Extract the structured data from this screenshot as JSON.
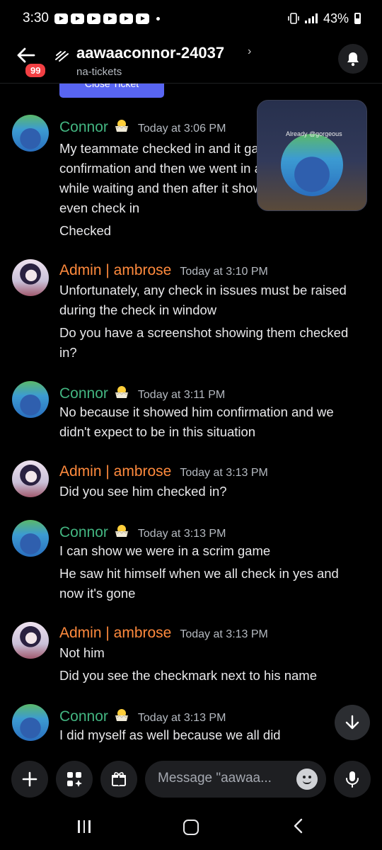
{
  "status_bar": {
    "time": "3:30",
    "battery": "43%"
  },
  "header": {
    "back_icon": "arrow-left-icon",
    "unread_badge": "99",
    "channel_title": "aawaaconnor-24037",
    "chevron": "›",
    "channel_subtitle": "na-tickets"
  },
  "close_ticket_label": "Close Ticket",
  "messages": [
    {
      "author": "Connor",
      "color": "#43b581",
      "time": "Today at 3:06 PM",
      "lines": [
        "My teammate checked in and it gave",
        "confirmation and then we went in a scrim",
        "while waiting and then after it showed",
        "even check in",
        "Checked"
      ]
    },
    {
      "author": "Admin | ambrose",
      "color": "#ff8a3d",
      "time": "Today at 3:10 PM",
      "lines": [
        "Unfortunately, any check in issues must be raised",
        "during the check in window",
        "Do you have a screenshot showing them checked",
        "in?"
      ]
    },
    {
      "author": "Connor",
      "color": "#43b581",
      "time": "Today at 3:11 PM",
      "lines": [
        "No because it showed him confirmation and we",
        "didn't expect to be in this situation"
      ]
    },
    {
      "author": "Admin | ambrose",
      "color": "#ff8a3d",
      "time": "Today at 3:13 PM",
      "lines": [
        "Did you see him checked in?"
      ]
    },
    {
      "author": "Connor",
      "color": "#43b581",
      "time": "Today at 3:13 PM",
      "lines": [
        "I can show we were in a scrim game",
        "He saw hit himself when we all check in yes and",
        "now it's gone"
      ]
    },
    {
      "author": "Admin | ambrose",
      "color": "#ff8a3d",
      "time": "Today at 3:13 PM",
      "lines": [
        "Not him",
        "Did you see the checkmark next to his name"
      ]
    },
    {
      "author": "Connor",
      "color": "#43b581",
      "time": "Today at 3:13 PM",
      "lines": [
        "I did myself as well because we all did"
      ]
    }
  ],
  "pip_label": "Already @gorgeous",
  "composer": {
    "placeholder": "Message \"aawaa...",
    "plus_icon": "plus-icon",
    "apps_icon": "apps-icon",
    "gift_icon": "gift-icon",
    "emoji_icon": "emoji-icon",
    "mic_icon": "mic-icon"
  }
}
